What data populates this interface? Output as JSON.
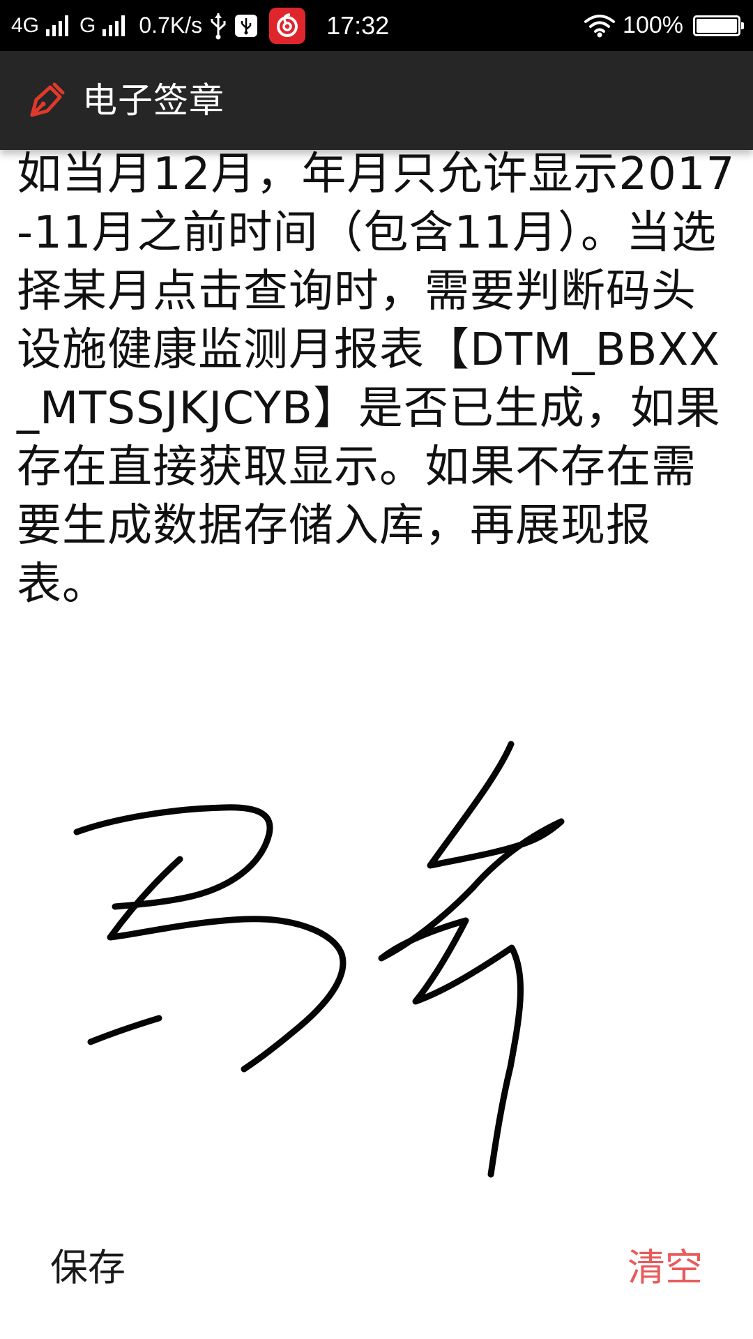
{
  "status_bar": {
    "network_4g": "4G",
    "network_g": "G",
    "speed": "0.7K/s",
    "time": "17:32",
    "battery": "100%",
    "battery_level": 1.0,
    "icons": [
      "signal-icon",
      "usb-icon",
      "usb-debug-icon",
      "netease-music-icon",
      "wifi-icon",
      "battery-icon"
    ]
  },
  "toolbar": {
    "title": "电子签章",
    "icon": "pen-nib-icon",
    "accent_color": "#e0392b"
  },
  "content": {
    "text": "如当月12月，年月只允许显示2017-11月之前时间（包含11月）。当选择某月点击查询时，需要判断码头设施健康监测月报表【DTM_BBXX_MTSSJKJCYB】是否已生成，如果存在直接获取显示。如果不存在需要生成数据存储入库，再展现报表。"
  },
  "actions": {
    "save_label": "保存",
    "clear_label": "清空",
    "clear_color": "#e95a5a"
  }
}
